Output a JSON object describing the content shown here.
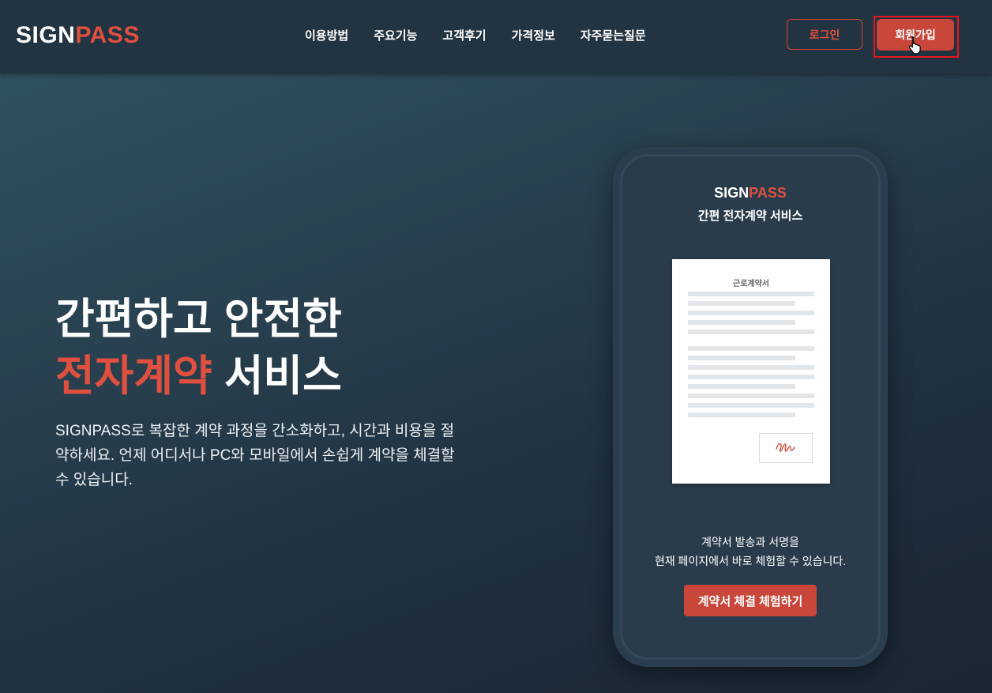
{
  "header": {
    "logo_sign": "SIGN",
    "logo_pass": "PASS",
    "nav": [
      "이용방법",
      "주요기능",
      "고객후기",
      "가격정보",
      "자주묻는질문"
    ],
    "login_label": "로그인",
    "join_label": "회원가입"
  },
  "hero": {
    "title_line1": "간편하고 안전한",
    "title_accent": "전자계약",
    "title_rest": " 서비스",
    "description": "SIGNPASS로 복잡한 계약 과정을 간소화하고, 시간과 비용을 절약하세요. 언제 어디서나 PC와 모바일에서 손쉽게 계약을 체결할 수 있습니다."
  },
  "phone": {
    "logo_sign": "SIGN",
    "logo_pass": "PASS",
    "subtitle": "간편 전자계약 서비스",
    "document_title": "근로계약서",
    "text_line1": "계약서 발송과 서명을",
    "text_line2": "현재 페이지에서 바로 체험할 수 있습니다.",
    "cta_label": "계약서 체결 체험하기"
  },
  "colors": {
    "accent": "#e0503f",
    "button": "#c8463a",
    "header_bg": "#223341",
    "highlight": "#e8151c"
  },
  "icons": [
    "pointer-hand-cursor-icon",
    "signature-icon"
  ]
}
